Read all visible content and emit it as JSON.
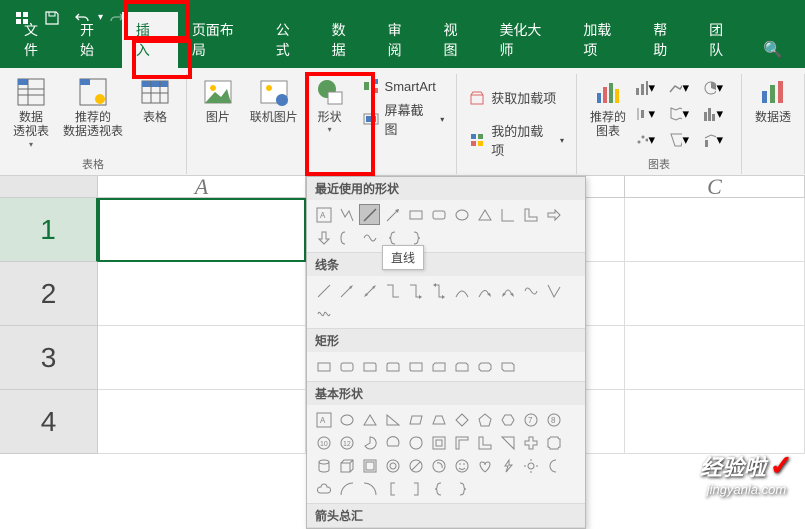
{
  "tabs": [
    "文件",
    "开始",
    "插入",
    "页面布局",
    "公式",
    "数据",
    "审阅",
    "视图",
    "美化大师",
    "加载项",
    "帮助",
    "团队"
  ],
  "activeTab": "插入",
  "groups": {
    "tables": {
      "label": "表格",
      "pivot": "数据\n透视表",
      "recommended": "推荐的\n数据透视表",
      "table": "表格"
    },
    "images": {
      "picture": "图片",
      "online": "联机图片"
    },
    "shapes": {
      "label": "形状",
      "smartart": "SmartArt",
      "screenshot": "屏幕截图"
    },
    "addins": {
      "get": "获取加载项",
      "my": "我的加载项"
    },
    "charts": {
      "label": "图表",
      "recommended": "推荐的\n图表",
      "data": "数据透"
    }
  },
  "shapesDropdown": {
    "recent": "最近使用的形状",
    "lines": "线条",
    "rects": "矩形",
    "basic": "基本形状",
    "arrows": "箭头总汇",
    "tooltip": "直线"
  },
  "columns": [
    "A",
    "",
    "C"
  ],
  "rows": [
    "1",
    "2",
    "3",
    "4"
  ],
  "watermark": {
    "text1": "经验啦",
    "text2": "jingyanla.com"
  }
}
